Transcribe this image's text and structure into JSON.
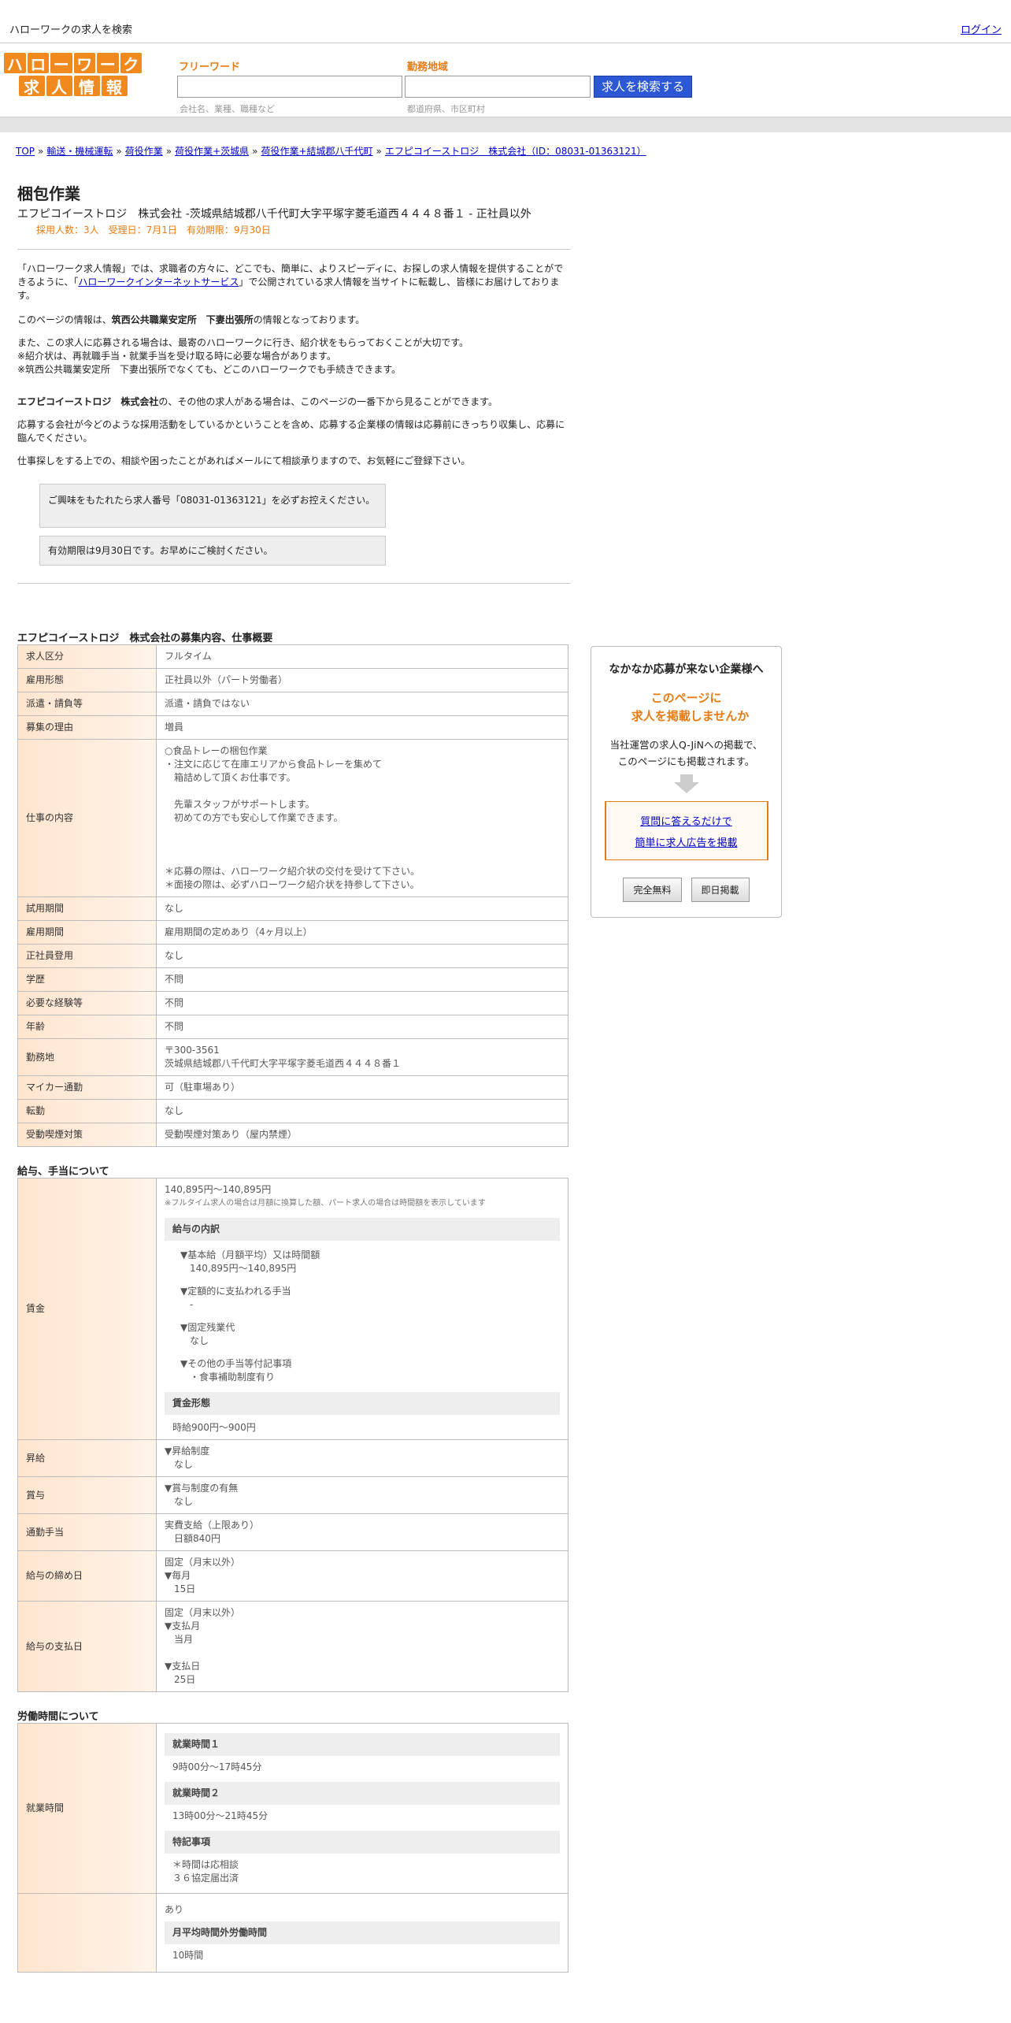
{
  "header": {
    "site_title": "ハローワークの求人を検索",
    "login": "ログイン"
  },
  "logo": {
    "row1": [
      "ハ",
      "ロ",
      "ー",
      "ワ",
      "ー",
      "ク"
    ],
    "row2": [
      "求",
      "人",
      "情",
      "報"
    ]
  },
  "search": {
    "freeword_label": "フリーワード",
    "freeword_hint": "会社名、業種、職種など",
    "location_label": "勤務地域",
    "location_hint": "都道府県、市区町村",
    "button": "求人を検索する"
  },
  "breadcrumb": [
    "TOP",
    "輸送・機械運転",
    "荷役作業",
    "荷役作業+茨城県",
    "荷役作業+結城郡八千代町",
    "エフピコイーストロジ　株式会社（ID：08031-01363121）"
  ],
  "job": {
    "title": "梱包作業",
    "subtitle": "エフピコイーストロジ　株式会社 -茨城県結城郡八千代町大字平塚字菱毛道西４４４８番１ - 正社員以外",
    "meta": "採用人数：3人　受理日：7月1日　有効期限：9月30日"
  },
  "intro": {
    "p1a": "「ハローワーク求人情報」では、求職者の方々に、どこでも、簡単に、よりスピーディに、お探しの求人情報を提供することができるように、「",
    "p1link": "ハローワークインターネットサービス",
    "p1b": "」で公開されている求人情報を当サイトに転載し、皆様にお届けしております。",
    "p2a": "このページの情報は、",
    "p2b": "筑西公共職業安定所　下妻出張所",
    "p2c": "の情報となっております。",
    "p3": "また、この求人に応募される場合は、最寄のハローワークに行き、紹介状をもらっておくことが大切です。",
    "p3b": "※紹介状は、再就職手当・就業手当を受け取る時に必要な場合があります。",
    "p3c": "※筑西公共職業安定所　下妻出張所でなくても、どこのハローワークでも手続きできます。",
    "p4a": "エフピコイーストロジ　株式会社",
    "p4b": "の、その他の求人がある場合は、このページの一番下から見ることができます。",
    "p5": "応募する会社が今どのような採用活動をしているかということを含め、応募する企業様の情報は応募前にきっちり収集し、応募に臨んでください。",
    "p6": "仕事探しをする上での、相談や困ったことがあればメールにて相談承りますので、お気軽にご登録下さい。",
    "note1": "ご興味をもたれたら求人番号「08031-01363121」を必ずお控えください。",
    "note2": "有効期限は9月30日です。お早めにご検討ください。"
  },
  "overview": {
    "heading": "エフピコイーストロジ　株式会社の募集内容、仕事概要",
    "rows": [
      {
        "k": "求人区分",
        "v": "フルタイム"
      },
      {
        "k": "雇用形態",
        "v": "正社員以外（パート労働者）"
      },
      {
        "k": "派遣・請負等",
        "v": "派遣・請負ではない"
      },
      {
        "k": "募集の理由",
        "v": "増員"
      },
      {
        "k": "仕事の内容",
        "v": "○食品トレーの梱包作業\n・注文に応じて在庫エリアから食品トレーを集めて\n　箱詰めして頂くお仕事です。\n\n　先輩スタッフがサポートします。\n　初めての方でも安心して作業できます。\n\n\n\n＊応募の際は、ハローワーク紹介状の交付を受けて下さい。\n＊面接の際は、必ずハローワーク紹介状を持参して下さい。"
      },
      {
        "k": "試用期間",
        "v": "なし"
      },
      {
        "k": "雇用期間",
        "v": "雇用期間の定めあり（4ヶ月以上）"
      },
      {
        "k": "正社員登用",
        "v": "なし"
      },
      {
        "k": "学歴",
        "v": "不問"
      },
      {
        "k": "必要な経験等",
        "v": "不問"
      },
      {
        "k": "年齢",
        "v": "不問"
      },
      {
        "k": "勤務地",
        "v": "〒300-3561\n茨城県結城郡八千代町大字平塚字菱毛道西４４４８番１"
      },
      {
        "k": "マイカー通勤",
        "v": "可（駐車場あり）"
      },
      {
        "k": "転勤",
        "v": "なし"
      },
      {
        "k": "受動喫煙対策",
        "v": "受動喫煙対策あり（屋内禁煙）"
      }
    ]
  },
  "salary": {
    "heading": "給与、手当について",
    "wage_label": "賃金",
    "wage_range": "140,895円〜140,895円",
    "wage_note": "※フルタイム求人の場合は月額に換算した額、パート求人の場合は時間額を表示しています",
    "breakdown_h": "給与の内訳",
    "b1": "▼基本給（月額平均）又は時間額\n　140,895円〜140,895円",
    "b2": "▼定額的に支払われる手当\n　-",
    "b3": "▼固定残業代\n　なし",
    "b4": "▼その他の手当等付記事項\n　・食事補助制度有り",
    "form_h": "賃金形態",
    "form_v": "時給900円〜900円",
    "rows": [
      {
        "k": "昇給",
        "v": "▼昇給制度\n　なし"
      },
      {
        "k": "賞与",
        "v": "▼賞与制度の有無\n　なし"
      },
      {
        "k": "通勤手当",
        "v": "実費支給（上限あり）\n　日額840円"
      },
      {
        "k": "給与の締め日",
        "v": "固定（月末以外）\n▼毎月\n　15日"
      },
      {
        "k": "給与の支払日",
        "v": "固定（月末以外）\n▼支払月\n　当月\n\n▼支払日\n　25日"
      }
    ]
  },
  "hours": {
    "heading": "労働時間について",
    "label": "就業時間",
    "h1": "就業時間１",
    "v1": "9時00分〜17時45分",
    "h2": "就業時間２",
    "v2": "13時00分〜21時45分",
    "h3": "特記事項",
    "v3": "＊時間は応相談\n３６協定届出済",
    "ot_v": "あり",
    "ot_h": "月平均時間外労働時間",
    "ot_val": "10時間"
  },
  "side": {
    "heading": "なかなか応募が来ない企業様へ",
    "orange1": "このページに",
    "orange2": "求人を掲載しませんか",
    "text1": "当社運営の求人Q-JiNへの掲載で、",
    "text2": "このページにも掲載されます。",
    "link1": "質問に答えるだけで",
    "link2": "簡単に求人広告を掲載",
    "btn1": "完全無料",
    "btn2": "即日掲載"
  }
}
